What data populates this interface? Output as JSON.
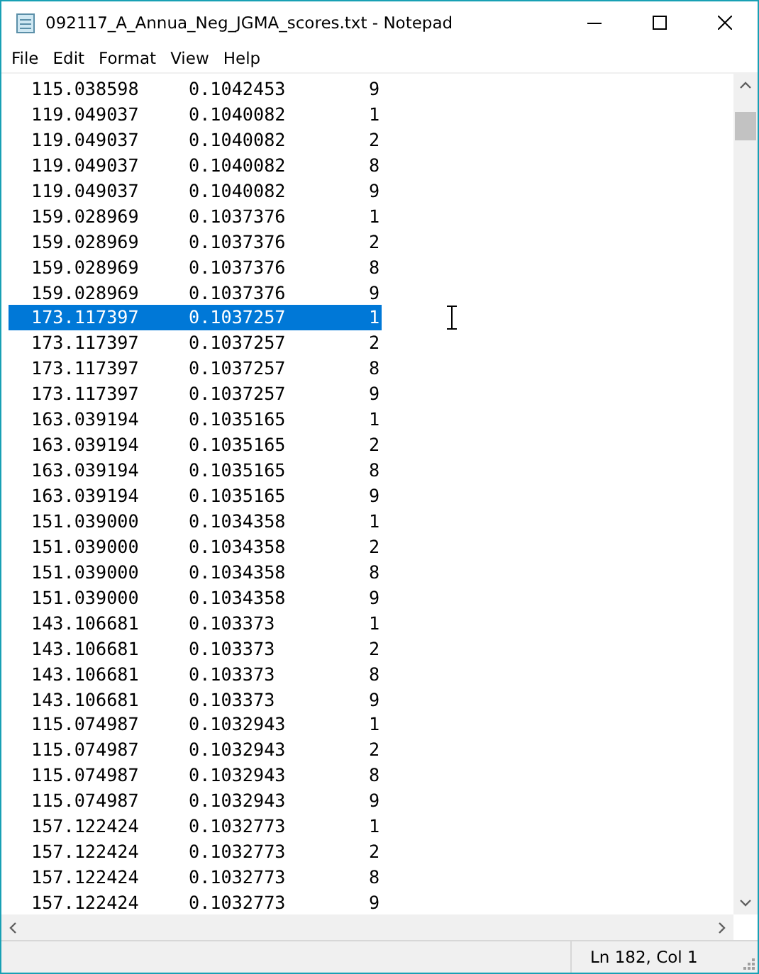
{
  "window": {
    "title": "092117_A_Annua_Neg_JGMA_scores.txt - Notepad"
  },
  "menu": [
    "File",
    "Edit",
    "Format",
    "View",
    "Help"
  ],
  "rows": [
    {
      "cols": [
        "115.038598",
        "0.1042453",
        "9"
      ],
      "selected": false
    },
    {
      "cols": [
        "119.049037",
        "0.1040082",
        "1"
      ],
      "selected": false
    },
    {
      "cols": [
        "119.049037",
        "0.1040082",
        "2"
      ],
      "selected": false
    },
    {
      "cols": [
        "119.049037",
        "0.1040082",
        "8"
      ],
      "selected": false
    },
    {
      "cols": [
        "119.049037",
        "0.1040082",
        "9"
      ],
      "selected": false
    },
    {
      "cols": [
        "159.028969",
        "0.1037376",
        "1"
      ],
      "selected": false
    },
    {
      "cols": [
        "159.028969",
        "0.1037376",
        "2"
      ],
      "selected": false
    },
    {
      "cols": [
        "159.028969",
        "0.1037376",
        "8"
      ],
      "selected": false
    },
    {
      "cols": [
        "159.028969",
        "0.1037376",
        "9"
      ],
      "selected": false
    },
    {
      "cols": [
        "173.117397",
        "0.1037257",
        "1"
      ],
      "selected": true
    },
    {
      "cols": [
        "173.117397",
        "0.1037257",
        "2"
      ],
      "selected": false
    },
    {
      "cols": [
        "173.117397",
        "0.1037257",
        "8"
      ],
      "selected": false
    },
    {
      "cols": [
        "173.117397",
        "0.1037257",
        "9"
      ],
      "selected": false
    },
    {
      "cols": [
        "163.039194",
        "0.1035165",
        "1"
      ],
      "selected": false
    },
    {
      "cols": [
        "163.039194",
        "0.1035165",
        "2"
      ],
      "selected": false
    },
    {
      "cols": [
        "163.039194",
        "0.1035165",
        "8"
      ],
      "selected": false
    },
    {
      "cols": [
        "163.039194",
        "0.1035165",
        "9"
      ],
      "selected": false
    },
    {
      "cols": [
        "151.039000",
        "0.1034358",
        "1"
      ],
      "selected": false
    },
    {
      "cols": [
        "151.039000",
        "0.1034358",
        "2"
      ],
      "selected": false
    },
    {
      "cols": [
        "151.039000",
        "0.1034358",
        "8"
      ],
      "selected": false
    },
    {
      "cols": [
        "151.039000",
        "0.1034358",
        "9"
      ],
      "selected": false
    },
    {
      "cols": [
        "143.106681",
        "0.103373",
        "1"
      ],
      "selected": false
    },
    {
      "cols": [
        "143.106681",
        "0.103373",
        "2"
      ],
      "selected": false
    },
    {
      "cols": [
        "143.106681",
        "0.103373",
        "8"
      ],
      "selected": false
    },
    {
      "cols": [
        "143.106681",
        "0.103373",
        "9"
      ],
      "selected": false
    },
    {
      "cols": [
        "115.074987",
        "0.1032943",
        "1"
      ],
      "selected": false
    },
    {
      "cols": [
        "115.074987",
        "0.1032943",
        "2"
      ],
      "selected": false
    },
    {
      "cols": [
        "115.074987",
        "0.1032943",
        "8"
      ],
      "selected": false
    },
    {
      "cols": [
        "115.074987",
        "0.1032943",
        "9"
      ],
      "selected": false
    },
    {
      "cols": [
        "157.122424",
        "0.1032773",
        "1"
      ],
      "selected": false
    },
    {
      "cols": [
        "157.122424",
        "0.1032773",
        "2"
      ],
      "selected": false
    },
    {
      "cols": [
        "157.122424",
        "0.1032773",
        "8"
      ],
      "selected": false
    },
    {
      "cols": [
        "157.122424",
        "0.1032773",
        "9"
      ],
      "selected": false
    }
  ],
  "status_bar": {
    "position": "Ln 182, Col 1"
  }
}
